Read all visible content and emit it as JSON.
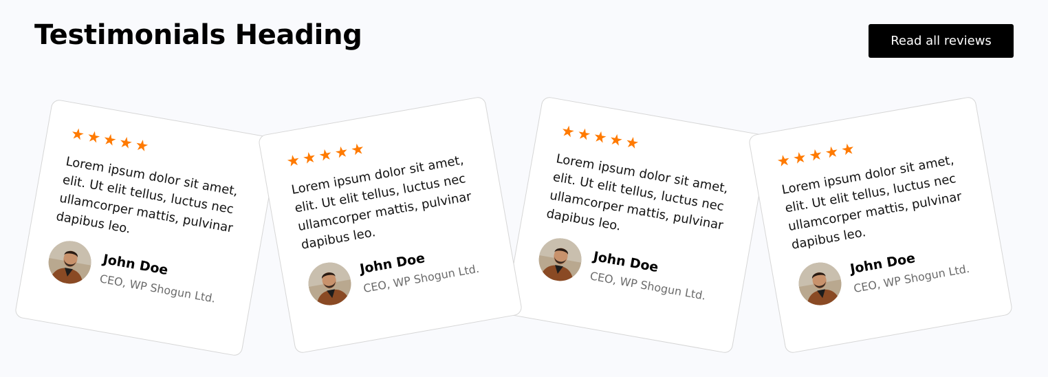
{
  "header": {
    "title": "Testimonials Heading",
    "read_all_label": "Read all reviews"
  },
  "colors": {
    "accent_star": "#ff7a00",
    "button_bg": "#000000",
    "page_bg": "#f9fafd"
  },
  "testimonials": [
    {
      "rating": 5,
      "quote": "Lorem ipsum dolor sit amet, elit. Ut elit tellus, luctus nec ullamcorper mattis, pulvinar dapibus leo.",
      "name": "John Doe",
      "role": "CEO, WP Shogun Ltd."
    },
    {
      "rating": 5,
      "quote": "Lorem ipsum dolor sit amet, elit. Ut elit tellus, luctus nec ullamcorper mattis, pulvinar dapibus leo.",
      "name": "John Doe",
      "role": "CEO, WP Shogun Ltd."
    },
    {
      "rating": 5,
      "quote": "Lorem ipsum dolor sit amet, elit. Ut elit tellus, luctus nec ullamcorper mattis, pulvinar dapibus leo.",
      "name": "John Doe",
      "role": "CEO, WP Shogun Ltd."
    },
    {
      "rating": 5,
      "quote": "Lorem ipsum dolor sit amet, elit. Ut elit tellus, luctus nec ullamcorper mattis, pulvinar dapibus leo.",
      "name": "John Doe",
      "role": "CEO, WP Shogun Ltd."
    }
  ]
}
